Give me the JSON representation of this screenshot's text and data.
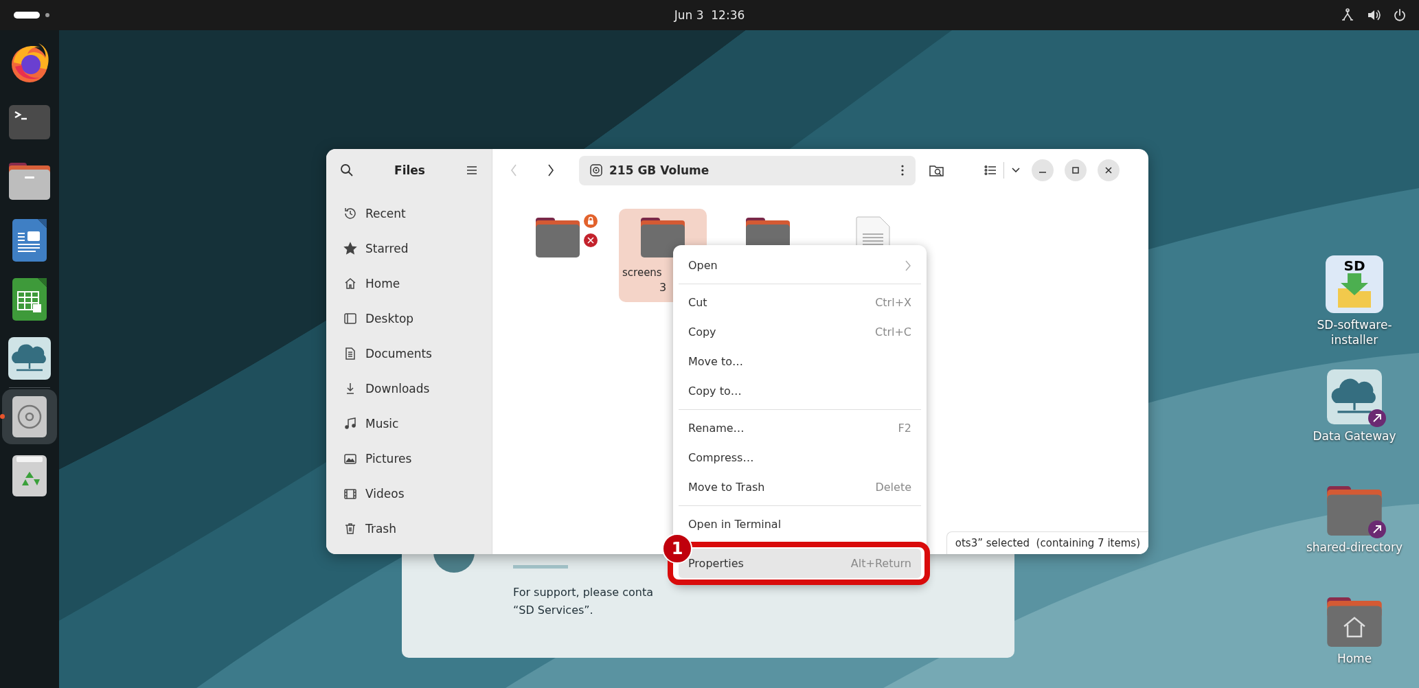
{
  "top_bar": {
    "clock": "Jun 3  12:36"
  },
  "dock": {
    "items": [
      {
        "kind": "browser",
        "selected": false,
        "running": false
      },
      {
        "kind": "terminal",
        "selected": false,
        "running": false
      },
      {
        "kind": "files",
        "selected": false,
        "running": false
      },
      {
        "kind": "writer",
        "selected": false,
        "running": false
      },
      {
        "kind": "calc",
        "selected": false,
        "running": false
      },
      {
        "kind": "gateway",
        "selected": false,
        "running": false
      },
      {
        "kind": "separator"
      },
      {
        "kind": "disc",
        "selected": true,
        "running": true
      },
      {
        "kind": "trash",
        "selected": false,
        "running": false
      }
    ]
  },
  "support_card": {
    "lines": [
      "For support, please conta",
      "“SD Services”."
    ]
  },
  "files_window": {
    "sidebar": {
      "title": "Files",
      "items": [
        {
          "kind": "recent",
          "label": "Recent",
          "selected": false
        },
        {
          "kind": "starred",
          "label": "Starred",
          "selected": false
        },
        {
          "kind": "home",
          "label": "Home",
          "selected": false
        },
        {
          "kind": "desktop",
          "label": "Desktop",
          "selected": false
        },
        {
          "kind": "documents",
          "label": "Documents",
          "selected": false
        },
        {
          "kind": "downloads",
          "label": "Downloads",
          "selected": false
        },
        {
          "kind": "music",
          "label": "Music",
          "selected": false
        },
        {
          "kind": "pictures",
          "label": "Pictures",
          "selected": false
        },
        {
          "kind": "videos",
          "label": "Videos",
          "selected": false
        },
        {
          "kind": "trash",
          "label": "Trash",
          "selected": false
        }
      ]
    },
    "nav": [
      {
        "kind": "back",
        "disabled": true
      },
      {
        "kind": "forward",
        "disabled": false
      }
    ],
    "path": "215 GB Volume",
    "items": [
      {
        "kind": "folder",
        "selected": false,
        "locked": true,
        "unreadable": true
      },
      {
        "kind": "folder",
        "selected": true,
        "locked": false,
        "unreadable": false,
        "label": [
          "screens",
          "3"
        ]
      },
      {
        "kind": "folder",
        "selected": false,
        "locked": false,
        "unreadable": false
      },
      {
        "kind": "document",
        "selected": false,
        "locked": false,
        "unreadable": false
      }
    ],
    "status": "ots3” selected  (containing 7 items)"
  },
  "context_menu": {
    "items": [
      {
        "kind": "entry",
        "label": "Open",
        "submenu": true,
        "highlighted": false
      },
      {
        "kind": "separator"
      },
      {
        "kind": "entry",
        "label": "Cut",
        "shortcut": "Ctrl+X",
        "submenu": false,
        "highlighted": false
      },
      {
        "kind": "entry",
        "label": "Copy",
        "shortcut": "Ctrl+C",
        "submenu": false,
        "highlighted": false
      },
      {
        "kind": "entry",
        "label": "Move to…",
        "submenu": false,
        "highlighted": false
      },
      {
        "kind": "entry",
        "label": "Copy to…",
        "submenu": false,
        "highlighted": false
      },
      {
        "kind": "separator"
      },
      {
        "kind": "entry",
        "label": "Rename…",
        "shortcut": "F2",
        "submenu": false,
        "highlighted": false
      },
      {
        "kind": "entry",
        "label": "Compress…",
        "submenu": false,
        "highlighted": false
      },
      {
        "kind": "entry",
        "label": "Move to Trash",
        "shortcut": "Delete",
        "submenu": false,
        "highlighted": false
      },
      {
        "kind": "separator"
      },
      {
        "kind": "entry",
        "label": "Open in Terminal",
        "submenu": false,
        "highlighted": false
      },
      {
        "kind": "entry",
        "label": "Properties",
        "shortcut": "Alt+Return",
        "submenu": false,
        "highlighted": true,
        "callout": "1"
      }
    ]
  },
  "desktop_icons": [
    {
      "kind": "installer",
      "label": "SD-software-installer",
      "logo_text": "SD",
      "shortcut": false
    },
    {
      "kind": "gateway",
      "label": "Data Gateway",
      "shortcut": true
    },
    {
      "kind": "folder",
      "label": "shared-directory",
      "shortcut": true
    },
    {
      "kind": "home",
      "label": "Home",
      "shortcut": false
    }
  ]
}
